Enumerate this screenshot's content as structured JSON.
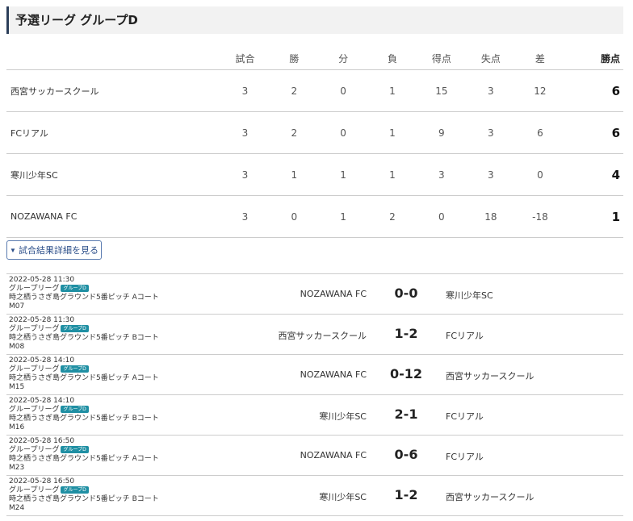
{
  "page": {
    "title": "予選リーグ グループD"
  },
  "standings": {
    "headers": {
      "team": "",
      "played": "試合",
      "won": "勝",
      "drawn": "分",
      "lost": "負",
      "gf": "得点",
      "ga": "失点",
      "gd": "差",
      "pts": "勝点"
    },
    "rows": [
      {
        "team": "西宮サッカースクール",
        "played": "3",
        "won": "2",
        "drawn": "0",
        "lost": "1",
        "gf": "15",
        "ga": "3",
        "gd": "12",
        "pts": "6"
      },
      {
        "team": "FCリアル",
        "played": "3",
        "won": "2",
        "drawn": "0",
        "lost": "1",
        "gf": "9",
        "ga": "3",
        "gd": "6",
        "pts": "6"
      },
      {
        "team": "寒川少年SC",
        "played": "3",
        "won": "1",
        "drawn": "1",
        "lost": "1",
        "gf": "3",
        "ga": "3",
        "gd": "0",
        "pts": "4"
      },
      {
        "team": "NOZAWANA FC",
        "played": "3",
        "won": "0",
        "drawn": "1",
        "lost": "2",
        "gf": "0",
        "ga": "18",
        "gd": "-18",
        "pts": "1"
      }
    ]
  },
  "details_button": {
    "label": "試合結果詳細を見る",
    "icon": "chevron-down-icon"
  },
  "matches": [
    {
      "datetime": "2022-05-28 11:30",
      "stage": "グループリーグ",
      "group": "グループD",
      "venue": "時之栖うさぎ島グラウンド5番ピッチ Aコート",
      "code": "M07",
      "home": "NOZAWANA FC",
      "score": "0-0",
      "away": "寒川少年SC"
    },
    {
      "datetime": "2022-05-28 11:30",
      "stage": "グループリーグ",
      "group": "グループD",
      "venue": "時之栖うさぎ島グラウンド5番ピッチ Bコート",
      "code": "M08",
      "home": "西宮サッカースクール",
      "score": "1-2",
      "away": "FCリアル"
    },
    {
      "datetime": "2022-05-28 14:10",
      "stage": "グループリーグ",
      "group": "グループD",
      "venue": "時之栖うさぎ島グラウンド5番ピッチ Aコート",
      "code": "M15",
      "home": "NOZAWANA FC",
      "score": "0-12",
      "away": "西宮サッカースクール"
    },
    {
      "datetime": "2022-05-28 14:10",
      "stage": "グループリーグ",
      "group": "グループD",
      "venue": "時之栖うさぎ島グラウンド5番ピッチ Bコート",
      "code": "M16",
      "home": "寒川少年SC",
      "score": "2-1",
      "away": "FCリアル"
    },
    {
      "datetime": "2022-05-28 16:50",
      "stage": "グループリーグ",
      "group": "グループD",
      "venue": "時之栖うさぎ島グラウンド5番ピッチ Aコート",
      "code": "M23",
      "home": "NOZAWANA FC",
      "score": "0-6",
      "away": "FCリアル"
    },
    {
      "datetime": "2022-05-28 16:50",
      "stage": "グループリーグ",
      "group": "グループD",
      "venue": "時之栖うさぎ島グラウンド5番ピッチ Bコート",
      "code": "M24",
      "home": "寒川少年SC",
      "score": "1-2",
      "away": "西宮サッカースクール"
    }
  ],
  "colors": {
    "accent": "#2c3e5a",
    "badge": "#1f8fa3",
    "button_border": "#5a7bb0"
  }
}
